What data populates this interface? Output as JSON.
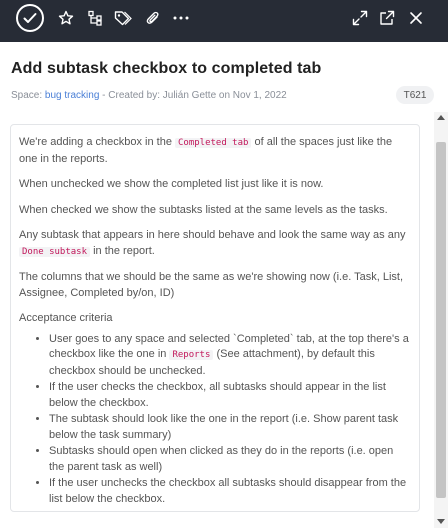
{
  "toolbar": {
    "icons": [
      "check-circle-icon",
      "star-icon",
      "subtasks-icon",
      "tag-icon",
      "paperclip-icon",
      "more-icon",
      "expand-icon",
      "open-external-icon",
      "close-icon"
    ],
    "background": "#272c36"
  },
  "task": {
    "title": "Add subtask checkbox to completed tab",
    "meta": {
      "space_prefix": "Space: ",
      "space_name": "bug tracking",
      "created_text": " - Created by: Julián Gette on Nov 1, 2022"
    },
    "id": "T621"
  },
  "description": {
    "p1": {
      "before": "We're adding a checkbox in the ",
      "code": "Completed tab",
      "after": " of all the spaces just like the one in the reports."
    },
    "p2": "When unchecked we show the completed list just like it is now.",
    "p3": "When checked we show the subtasks listed at the same levels as the tasks.",
    "p4": {
      "before": "Any subtask that appears in here should behave and look the same way as any ",
      "code": "Done subtask",
      "after": " in the report."
    },
    "p5": "The columns that we should be the same as we're showing now (i.e. Task, List, Assignee, Completed by/on, ID)",
    "acceptance_heading": "Acceptance criteria",
    "criteria": {
      "c1": {
        "before": "User goes to any space and selected `Completed` tab, at the top there's a checkbox like the one in ",
        "code": "Reports",
        "after": " (See attachment), by default this checkbox should be unchecked."
      },
      "c2": " If the user checks the checkbox, all subtasks should appear in the list below the checkbox.",
      "c3": "The subtask should look like the one in the report (i.e. Show parent task below the task summary)",
      "c4": "Subtasks should open when clicked as they do in the reports (i.e. open the parent task as well)",
      "c5": "If the user unchecks the checkbox all subtasks should disappear from the list below the checkbox."
    }
  },
  "colors": {
    "accent_link": "#4a7fd6",
    "code_text": "#c2185b"
  }
}
